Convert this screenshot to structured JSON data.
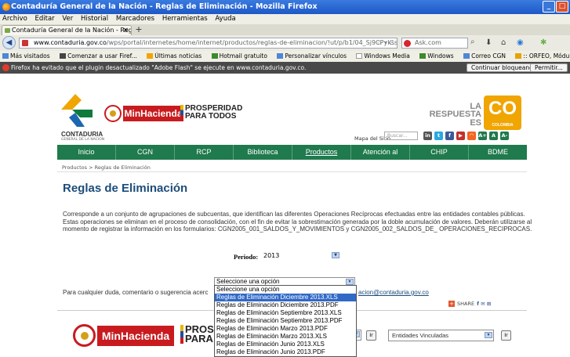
{
  "window": {
    "title": "Contaduría General de la Nación - Reglas de Eliminación - Mozilla Firefox"
  },
  "menu": [
    "Archivo",
    "Editar",
    "Ver",
    "Historial",
    "Marcadores",
    "Herramientas",
    "Ayuda"
  ],
  "tab": {
    "label": "Contaduría General de la Nación - Reglas de ..."
  },
  "address": {
    "url_host": "www.contaduria.gov.co",
    "url_path": "/wps/portal/internetes/home/internet/productos/reglas-de-eliminacion/!ut/p/b1/04_Sj9CPykssy0xPLM",
    "search_text": "Ask.com"
  },
  "bookmarks": [
    "Más visitados",
    "Comenzar a usar Firef...",
    "Últimas noticias",
    "Hotmail gratuito",
    "Personalizar vínculos",
    "Windows Media",
    "Windows",
    "Correo CGN",
    ":: ORFEO, Módulo de..."
  ],
  "flash_bar": {
    "message": "Firefox ha evitado que el plugin desactualizado \"Adobe Flash\" se ejecute en www.contaduria.gov.co.",
    "continue_label": "Continuar bloqueando",
    "allow_label": "Permitir..."
  },
  "header": {
    "cgn_name": "CONTADURIA",
    "cgn_sub": "GENERAL DE LA NACION",
    "minhacienda": "MinHacienda",
    "prosperidad_1": "PROSPERIDAD",
    "prosperidad_2": "PARA TODOS",
    "la": "LA",
    "respuesta": "RESPUESTA",
    "es": "ES",
    "co": "CO",
    "colombia": "COLOMBIA",
    "mapa": "Mapa del Sitio",
    "buscar": "Buscar..."
  },
  "nav": [
    "Inicio",
    "CGN",
    "RCP",
    "Biblioteca Contable",
    "Productos",
    "Atención al Usuario",
    "CHIP",
    "BDME"
  ],
  "breadcrumb": "Productos > Reglas de Eliminación",
  "page_title": "Reglas de Eliminación",
  "description": "Corresponde a un conjunto de agrupaciones de subcuentas, que identifican las diferentes Operaciones Recíprocas efectuadas entre las entidades contables públicas. Estas operaciones se eliminan en el proceso de consolidación, con el fin de evitar la sobrestimación generada por la doble acumulación de valores. Deberán utilizarse al momento de registrar la información en los formularios: CGN2005_001_SALDOS_Y_MOVIMIENTOS y CGN2005_002_SALDOS_DE_ OPERACIONES_RECIPROCAS.",
  "periodo": {
    "label": "Periodo:",
    "value": "2013"
  },
  "options_select": {
    "value": "Seleccione una opción",
    "options": [
      "Seleccione una opción",
      "Reglas de Eliminación Diciembre 2013.XLS",
      "Reglas de Eliminación Diciembre 2013.PDF",
      "Reglas de Eliminación Septiembre 2013.XLS",
      "Reglas de Eliminación Septiembre 2013.PDF",
      "Reglas de Eliminación Marzo 2013.PDF",
      "Reglas de Eliminación Marzo 2013.XLS",
      "Reglas de Eliminación Junio 2013.XLS",
      "Reglas de Eliminación Junio 2013.PDF"
    ],
    "highlighted_index": 1
  },
  "contact": {
    "prefix": "Para cualquier duda, comentario o sugerencia acerc",
    "email": "acion@contaduria.gov.co"
  },
  "share": {
    "label": "SHARE"
  },
  "footer": {
    "minhacienda": "MinHacienda",
    "prosperidad_1": "PROSPI",
    "prosperidad_2": "PARA T",
    "ir_label": "Ir",
    "entidades": "Entidades Vinculadas"
  }
}
